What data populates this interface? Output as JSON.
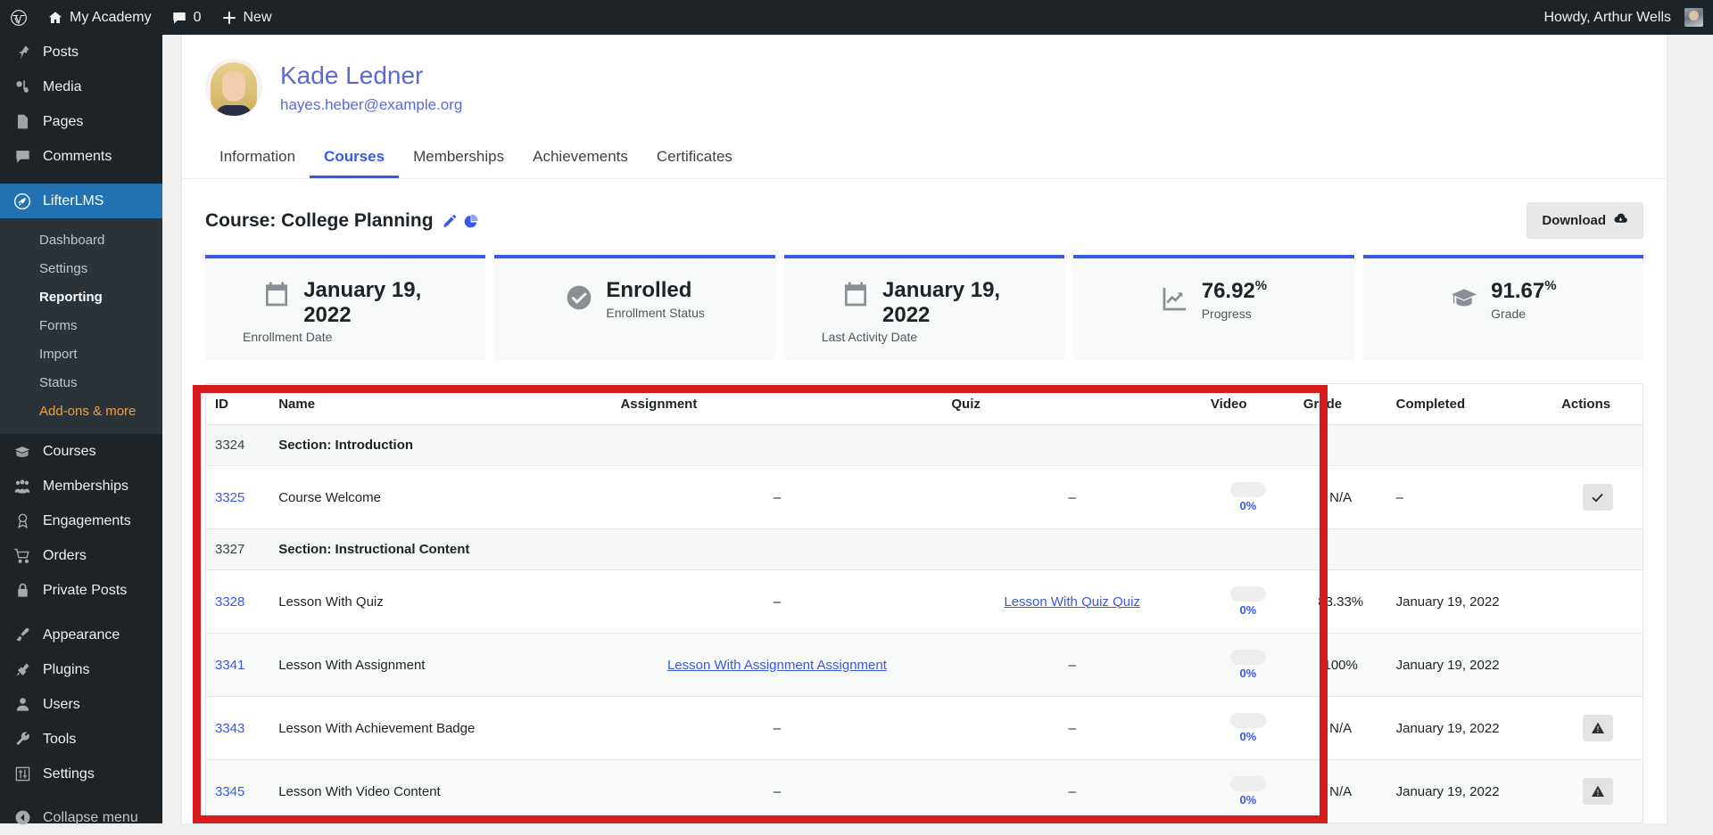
{
  "adminbar": {
    "logo_icon": "wordpress-logo-icon",
    "site_name": "My Academy",
    "comments_count": "0",
    "new_label": "New",
    "howdy": "Howdy, Arthur Wells"
  },
  "sidebar": {
    "items": [
      {
        "label": "Posts",
        "icon": "pin-icon"
      },
      {
        "label": "Media",
        "icon": "media-icon"
      },
      {
        "label": "Pages",
        "icon": "page-icon"
      },
      {
        "label": "Comments",
        "icon": "comment-icon"
      },
      {
        "label": "LifterLMS",
        "icon": "rocket-icon",
        "current": true
      },
      {
        "label": "Courses",
        "icon": "graduation-cap-icon"
      },
      {
        "label": "Memberships",
        "icon": "groups-icon"
      },
      {
        "label": "Engagements",
        "icon": "award-icon"
      },
      {
        "label": "Orders",
        "icon": "cart-icon"
      },
      {
        "label": "Private Posts",
        "icon": "lock-icon"
      },
      {
        "label": "Appearance",
        "icon": "paintbrush-icon"
      },
      {
        "label": "Plugins",
        "icon": "plug-icon"
      },
      {
        "label": "Users",
        "icon": "user-icon"
      },
      {
        "label": "Tools",
        "icon": "wrench-icon"
      },
      {
        "label": "Settings",
        "icon": "sliders-icon"
      }
    ],
    "submenu": [
      {
        "label": "Dashboard"
      },
      {
        "label": "Settings"
      },
      {
        "label": "Reporting",
        "active": true
      },
      {
        "label": "Forms"
      },
      {
        "label": "Import"
      },
      {
        "label": "Status"
      },
      {
        "label": "Add-ons & more",
        "highlight": true
      }
    ],
    "collapse": {
      "label": "Collapse menu",
      "icon": "collapse-arrow-icon"
    }
  },
  "student": {
    "name": "Kade Ledner",
    "email": "hayes.heber@example.org",
    "avatar_icon": "student-avatar"
  },
  "tabs": [
    {
      "label": "Information"
    },
    {
      "label": "Courses",
      "active": true
    },
    {
      "label": "Memberships"
    },
    {
      "label": "Achievements"
    },
    {
      "label": "Certificates"
    }
  ],
  "course": {
    "title": "Course: College Planning",
    "edit_icon": "pencil-icon",
    "chart_icon": "pie-chart-icon",
    "download_label": "Download",
    "download_icon": "cloud-download-icon"
  },
  "stats": [
    {
      "value": "January 19, 2022",
      "sublabel": "Enrollment Date",
      "icon": "calendar-icon",
      "type": "date"
    },
    {
      "value": "Enrolled",
      "sublabel": "Enrollment Status",
      "icon": "check-circle-icon",
      "type": "status"
    },
    {
      "value": "January 19, 2022",
      "sublabel": "Last Activity Date",
      "icon": "calendar-icon",
      "type": "date"
    },
    {
      "value": "76.92",
      "suffix": "%",
      "sublabel": "Progress",
      "icon": "trend-up-icon",
      "type": "percent"
    },
    {
      "value": "91.67",
      "suffix": "%",
      "sublabel": "Grade",
      "icon": "graduation-cap-icon",
      "type": "percent"
    }
  ],
  "table": {
    "columns": [
      "ID",
      "Name",
      "Assignment",
      "Quiz",
      "Video",
      "Grade",
      "Completed",
      "Actions"
    ],
    "rows": [
      {
        "kind": "section",
        "id": "3324",
        "name": "Section: Introduction"
      },
      {
        "kind": "lesson",
        "id": "3325",
        "name": "Course Welcome",
        "assignment": "–",
        "quiz": "–",
        "video_pct": "0%",
        "grade": "N/A",
        "completed": "–",
        "action_icon": "check-icon"
      },
      {
        "kind": "section",
        "id": "3327",
        "name": "Section: Instructional Content"
      },
      {
        "kind": "lesson",
        "id": "3328",
        "name": "Lesson With Quiz",
        "assignment": "–",
        "quiz": "Lesson With Quiz Quiz",
        "quiz_link": true,
        "video_pct": "0%",
        "grade": "83.33%",
        "completed": "January 19, 2022",
        "action_icon": null
      },
      {
        "kind": "lesson",
        "id": "3341",
        "name": "Lesson With Assignment",
        "assignment": "Lesson With Assignment  Assignment",
        "assignment_link": true,
        "quiz": "–",
        "video_pct": "0%",
        "grade": "100%",
        "completed": "January 19, 2022",
        "action_icon": null
      },
      {
        "kind": "lesson",
        "id": "3343",
        "name": "Lesson With Achievement Badge",
        "assignment": "–",
        "quiz": "–",
        "video_pct": "0%",
        "grade": "N/A",
        "completed": "January 19, 2022",
        "action_icon": "warning-icon"
      },
      {
        "kind": "lesson",
        "id": "3345",
        "name": "Lesson With Video Content",
        "assignment": "–",
        "quiz": "–",
        "video_pct": "0%",
        "grade": "N/A",
        "completed": "January 19, 2022",
        "action_icon": "warning-icon"
      }
    ]
  },
  "highlight": {
    "color": "#d61c1c"
  }
}
